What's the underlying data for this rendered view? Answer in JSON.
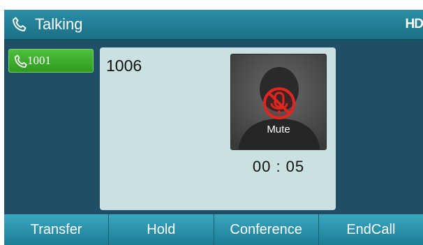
{
  "status_bar": {
    "title": "Talking",
    "hd_label": "HD",
    "icon": "phone-handset-icon"
  },
  "line_key": {
    "label": "1001",
    "icon": "phone-handset-icon",
    "color": "#3fae2f"
  },
  "call": {
    "number": "1006",
    "mute_label": "Mute",
    "mute_icon": "muted-microphone-icon",
    "avatar_icon": "person-silhouette-icon",
    "duration": "00 : 05"
  },
  "softkeys": [
    {
      "label": "Transfer"
    },
    {
      "label": "Hold"
    },
    {
      "label": "Conference"
    },
    {
      "label": "EndCall"
    }
  ],
  "colors": {
    "background": "#1f4f66",
    "title_bar": "#2280a0",
    "panel": "#cbe0e1",
    "mute_ring": "#e0261f"
  }
}
